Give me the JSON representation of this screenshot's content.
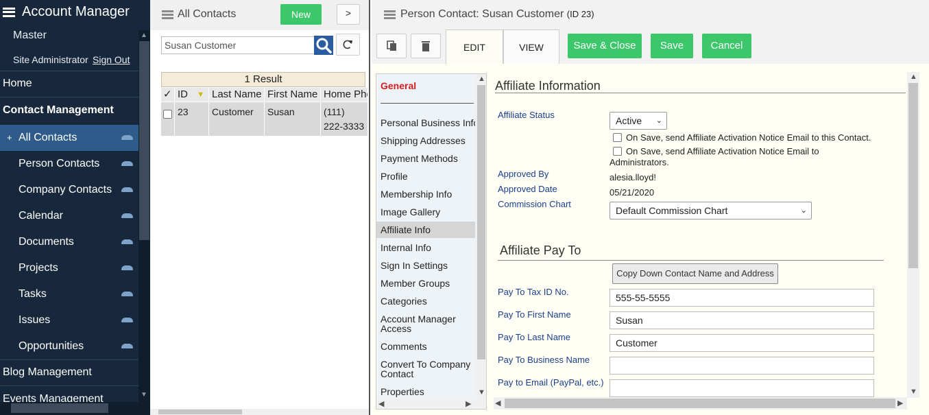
{
  "nav": {
    "app_title": "Account Manager",
    "site": "Master",
    "user_role": "Site Administrator",
    "sign_out": "Sign Out",
    "items": [
      {
        "label": "Home"
      },
      {
        "label": "Contact Management"
      },
      {
        "label": "All Contacts",
        "prefix": "+"
      },
      {
        "label": "Person Contacts"
      },
      {
        "label": "Company Contacts"
      },
      {
        "label": "Calendar"
      },
      {
        "label": "Documents"
      },
      {
        "label": "Projects"
      },
      {
        "label": "Tasks"
      },
      {
        "label": "Issues"
      },
      {
        "label": "Opportunities"
      },
      {
        "label": "Blog Management"
      },
      {
        "label": "Events Management"
      }
    ]
  },
  "list": {
    "title": "All Contacts",
    "new_button": "New",
    "expand_button": ">",
    "search_value": "Susan Customer",
    "result_count": "1 Result",
    "columns": [
      "✓",
      "ID",
      "Last Name",
      "First Name",
      "Home Phone"
    ],
    "rows": [
      {
        "id": "23",
        "last_name": "Customer",
        "first_name": "Susan",
        "home_phone_1": "(111)",
        "home_phone_2": "222-3333"
      }
    ]
  },
  "editor": {
    "title": "Person Contact: Susan Customer",
    "title_id": "(ID 23)",
    "tabs": {
      "edit": "EDIT",
      "view": "VIEW"
    },
    "buttons": {
      "save_close": "Save & Close",
      "save": "Save",
      "cancel": "Cancel"
    },
    "subnav": {
      "general": "General",
      "items": [
        "Personal Business Info",
        "Shipping Addresses",
        "Payment Methods",
        "Profile",
        "Membership Info",
        "Image Gallery",
        "Affiliate Info",
        "Internal Info",
        "Sign In Settings",
        "Member Groups",
        "Categories",
        "Account Manager Access",
        "Comments",
        "Convert To Company Contact",
        "Properties"
      ],
      "selected": "Affiliate Info"
    },
    "affiliate": {
      "heading": "Affiliate Information",
      "status_label": "Affiliate Status",
      "status_value": "Active",
      "notice_contact": "On Save, send Affiliate Activation Notice Email to this Contact.",
      "notice_admins": "On Save, send Affiliate Activation Notice Email to Administrators.",
      "approved_by_label": "Approved By",
      "approved_by_value": "alesia.lloyd!",
      "approved_date_label": "Approved Date",
      "approved_date_value": "05/21/2020",
      "commission_label": "Commission Chart",
      "commission_value": "Default Commission Chart"
    },
    "pay_to": {
      "heading": "Affiliate Pay To",
      "copy_button": "Copy Down Contact Name and Address",
      "tax_id_label": "Pay To Tax ID No.",
      "tax_id_value": "555-55-5555",
      "first_name_label": "Pay To First Name",
      "first_name_value": "Susan",
      "last_name_label": "Pay To Last Name",
      "last_name_value": "Customer",
      "business_label": "Pay To Business Name",
      "business_value": "",
      "email_label": "Pay to Email (PayPal, etc.)",
      "email_value": ""
    }
  }
}
